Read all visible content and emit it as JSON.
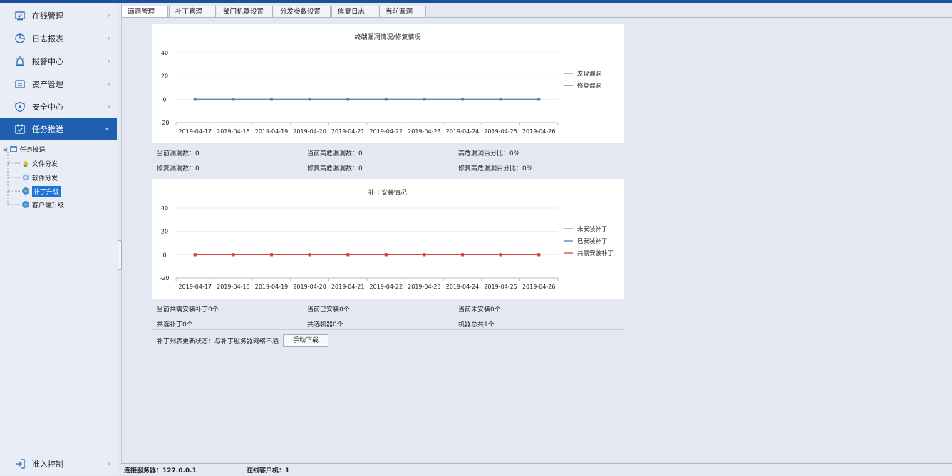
{
  "sidebar": {
    "items": [
      {
        "label": "在线管理",
        "icon": "monitor-icon"
      },
      {
        "label": "日志报表",
        "icon": "pie-chart-icon"
      },
      {
        "label": "报警中心",
        "icon": "alarm-icon"
      },
      {
        "label": "资产管理",
        "icon": "asset-icon"
      },
      {
        "label": "安全中心",
        "icon": "shield-icon"
      },
      {
        "label": "任务推送",
        "icon": "task-icon",
        "active": true
      }
    ],
    "tree": {
      "root": "任务推送",
      "children": [
        "文件分发",
        "软件分发",
        "补丁升级",
        "客户端升级"
      ],
      "selected": "补丁升级"
    },
    "bottom_item": {
      "label": "准入控制",
      "icon": "login-arrow-icon"
    }
  },
  "tabs": [
    "漏洞管理",
    "补丁管理",
    "部门机器设置",
    "分发参数设置",
    "修复日志",
    "当前漏洞"
  ],
  "active_tab": "漏洞管理",
  "vuln_stats": {
    "current_vulns": "当前漏洞数：0",
    "current_high": "当前高危漏洞数：0",
    "high_pct": "高危漏洞百分比：0%",
    "fixed_vulns": "修复漏洞数：0",
    "fixed_high": "修复高危漏洞数：0",
    "fixed_high_pct": "修复高危漏洞百分比：0%"
  },
  "patch_stats": {
    "need_install": "当前共需安装补丁0个",
    "installed": "当前已安装0个",
    "not_installed": "当前未安装0个",
    "selected_patches": "共选补丁0个",
    "selected_machines": "共选机器0个",
    "total_machines": "机器总共1个"
  },
  "patch_list_status": "补丁列表更新状态：与补丁服务器网络不通",
  "download_button": "手动下载",
  "status_bar": {
    "server": "连接服务器：127.0.0.1",
    "online_clients": "在线客户机：1"
  },
  "chart_data": [
    {
      "type": "line",
      "title": "终端漏洞情况/修复情况",
      "categories": [
        "2019-04-17",
        "2019-04-18",
        "2019-04-19",
        "2019-04-20",
        "2019-04-21",
        "2019-04-22",
        "2019-04-23",
        "2019-04-24",
        "2019-04-25",
        "2019-04-26"
      ],
      "yticks": [
        40,
        20,
        0,
        -20
      ],
      "ylim": [
        -20,
        40
      ],
      "legend_position": "right",
      "series": [
        {
          "name": "发现漏洞",
          "color": "#e8823a",
          "values": [
            0,
            0,
            0,
            0,
            0,
            0,
            0,
            0,
            0,
            0
          ]
        },
        {
          "name": "修复漏洞",
          "color": "#4f7fc4",
          "values": [
            0,
            0,
            0,
            0,
            0,
            0,
            0,
            0,
            0,
            0
          ]
        }
      ]
    },
    {
      "type": "line",
      "title": "补丁安装情况",
      "categories": [
        "2019-04-17",
        "2019-04-18",
        "2019-04-19",
        "2019-04-20",
        "2019-04-21",
        "2019-04-22",
        "2019-04-23",
        "2019-04-24",
        "2019-04-25",
        "2019-04-26"
      ],
      "yticks": [
        40,
        20,
        0,
        -20
      ],
      "ylim": [
        -20,
        40
      ],
      "legend_position": "right",
      "series": [
        {
          "name": "未安装补丁",
          "color": "#e8823a",
          "values": [
            0,
            0,
            0,
            0,
            0,
            0,
            0,
            0,
            0,
            0
          ]
        },
        {
          "name": "已安装补丁",
          "color": "#4f7fc4",
          "values": [
            0,
            0,
            0,
            0,
            0,
            0,
            0,
            0,
            0,
            0
          ]
        },
        {
          "name": "共需安装补丁",
          "color": "#d94040",
          "values": [
            0,
            0,
            0,
            0,
            0,
            0,
            0,
            0,
            0,
            0
          ]
        }
      ]
    }
  ]
}
